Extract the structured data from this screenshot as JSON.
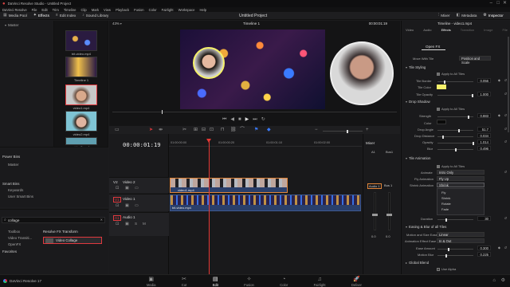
{
  "window": {
    "title": "DaVinci Resolve Studio - Untitled Project",
    "app_name": "DaVinci Resolve 17"
  },
  "menu": [
    "DaVinci Resolve",
    "File",
    "Edit",
    "Trim",
    "Timeline",
    "Clip",
    "Mark",
    "View",
    "Playback",
    "Fusion",
    "Color",
    "Fairlight",
    "Workspace",
    "Help"
  ],
  "toolbar": {
    "media_pool": "Media Pool",
    "effects": "Effects",
    "edit_index": "Edit Index",
    "sound_library": "Sound Library",
    "project_title": "Untitled Project",
    "mixer": "Mixer",
    "metadata": "Metadata",
    "inspector": "Inspector"
  },
  "media": {
    "bin": "Master",
    "clips": [
      "Timeline 1",
      "video1.mp4",
      "video2.mp4",
      "video3.mp4"
    ],
    "top_clip": "bit-video.mp4"
  },
  "bins": {
    "power_bins": "Power Bins",
    "power_master": "Master",
    "smart_bins": "Smart Bins",
    "keywords": "Keywords",
    "user_smart_bins": "User Smart Bins"
  },
  "effects_panel": {
    "search_value": "collage",
    "toolbox": "Toolbox",
    "video_transitions": "Video Transiti...",
    "open_fx": "OpenFX",
    "favorites": "Favorites",
    "category": "Resolve FX Transform",
    "result": "Video Collage"
  },
  "viewer": {
    "zoom": "43%",
    "timeline_name": "Timeline 1",
    "timecode": "00:00:01:19",
    "clip_name": "Untitled Project"
  },
  "inspector": {
    "clip": "Timeline - video1.mp4",
    "tabs": [
      "Video",
      "Audio",
      "Effects",
      "Transition",
      "Image",
      "File"
    ],
    "open_fx_tab": "Open FX",
    "move_with_tile": {
      "label": "Move With Tile",
      "value": "Position and Scale"
    },
    "tile_styling": "Tile Styling",
    "apply_all_1": "Apply to All Tiles",
    "tile_border": {
      "label": "Tile Border",
      "value": "0.056"
    },
    "tile_color": {
      "label": "Tile Color",
      "color": "#f4f06a"
    },
    "tile_opacity": {
      "label": "Tile Opacity",
      "value": "1.000"
    },
    "drop_shadow": "Drop Shadow",
    "apply_all_2": "Apply to All Tiles",
    "strength": {
      "label": "Strength",
      "value": "0.883"
    },
    "color": {
      "label": "Color",
      "color": "#0a0a0a"
    },
    "drop_angle": {
      "label": "Drop Angle",
      "value": "51.7"
    },
    "drop_distance": {
      "label": "Drop Distance",
      "value": "0.034"
    },
    "opacity": {
      "label": "Opacity",
      "value": "1.014"
    },
    "blur": {
      "label": "Blur",
      "value": "0.496"
    },
    "tile_animation": "Tile Animation",
    "apply_all_3": "Apply to All Tiles",
    "animate": {
      "label": "Animate",
      "value": "Intro Only"
    },
    "fly_animation": {
      "label": "Fly Animation",
      "value": "Fly Up"
    },
    "shrink_anim": {
      "label": "Shrink Animation",
      "value": "Shrink"
    },
    "dropdown_options": [
      "Fly",
      "Shrink",
      "Rotate",
      "Fade"
    ],
    "duration": {
      "label": "Duration",
      "value": "30"
    },
    "easing": "Easing & Blur of all Tiles",
    "motion_ease": {
      "label": "Motion and Size Ease",
      "value": "Linear"
    },
    "anim_effect": {
      "label": "Animation Effect Ease",
      "value": "In & Out"
    },
    "ease_amount": {
      "label": "Ease Amount",
      "value": "0.300"
    },
    "motion_blur": {
      "label": "Motion Blur",
      "value": "0.225"
    },
    "global_blend": "Global Blend",
    "use_alpha": "Use Alpha"
  },
  "timeline": {
    "timecode": "00:00:01:19",
    "ruler": [
      "01:00:00:00",
      "01:00:00:20",
      "01:00:01:10",
      "01:00:02:00"
    ],
    "v2": {
      "id": "V2",
      "name": "Video 2",
      "clip": "video1.mp4"
    },
    "v1": {
      "id": "V1",
      "name": "Video 1",
      "clip": "bit-video.mp4"
    },
    "a1": {
      "id": "A1",
      "name": "Audio 1"
    }
  },
  "mixer": {
    "title": "Mixer",
    "a1": "A1",
    "bus1": "Bus1",
    "audio1": "Audio 1",
    "bus1_lbl": "Bus 1",
    "val_a1": "0.0",
    "val_bus": "0.0"
  },
  "pages": [
    "Media",
    "Cut",
    "Edit",
    "Fusion",
    "Color",
    "Fairlight",
    "Deliver"
  ],
  "active_page": "Edit",
  "colors": {
    "accent_red": "#e0393e",
    "playhead": "#e53935",
    "track_blue": "#2a3f6b",
    "selection_orange": "#e0853a"
  }
}
